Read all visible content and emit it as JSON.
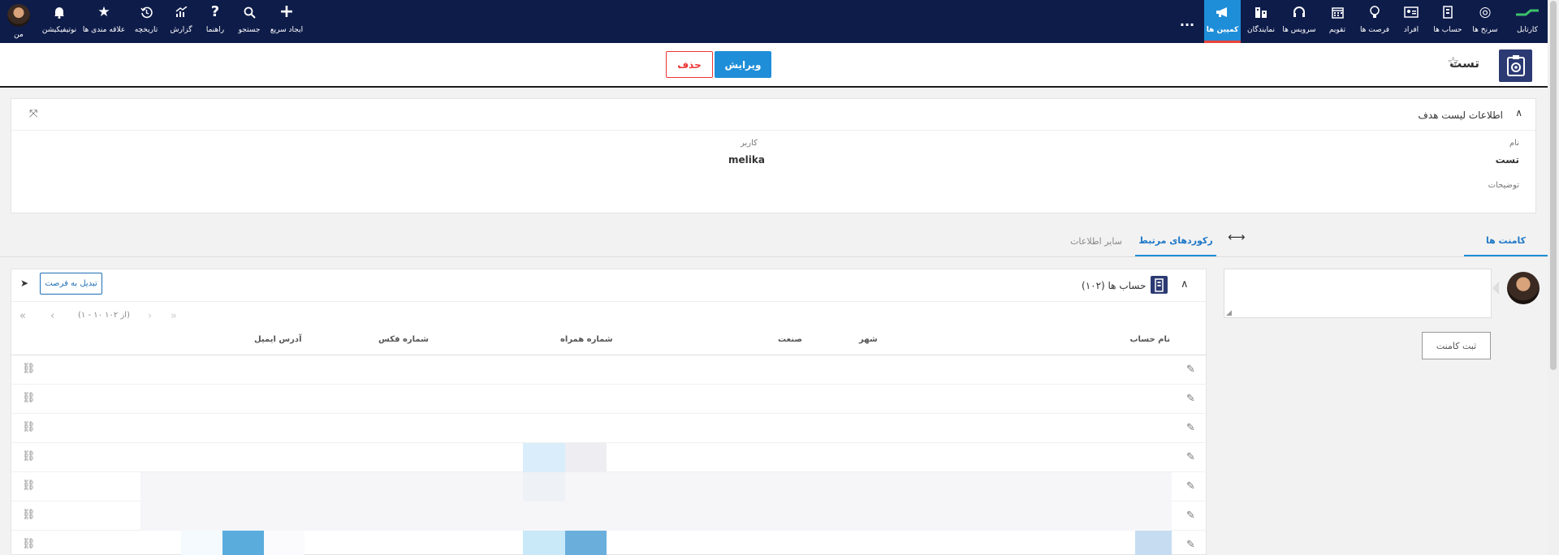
{
  "topnav": {
    "items": [
      {
        "label": "کارتابل",
        "icon": "dash-icon"
      },
      {
        "label": "سرنخ ها",
        "icon": "target-icon"
      },
      {
        "label": "حساب ها",
        "icon": "building-icon"
      },
      {
        "label": "افراد",
        "icon": "contact-card-icon"
      },
      {
        "label": "فرصت ها",
        "icon": "bulb-icon"
      },
      {
        "label": "تقویم",
        "icon": "calendar-icon"
      },
      {
        "label": "سرویس ها",
        "icon": "headset-icon"
      },
      {
        "label": "نمایندگان",
        "icon": "buildings-icon"
      },
      {
        "label": "کمپین ها",
        "icon": "megaphone-icon"
      }
    ],
    "more": "...",
    "left_items": [
      {
        "label": "ایجاد سریع",
        "icon": "plus-icon"
      },
      {
        "label": "جستجو",
        "icon": "search-icon"
      },
      {
        "label": "راهنما",
        "icon": "help-icon"
      },
      {
        "label": "گزارش",
        "icon": "chart-icon"
      },
      {
        "label": "تاریخچه",
        "icon": "history-icon"
      },
      {
        "label": "علاقه مندی ها",
        "icon": "star-icon"
      },
      {
        "label": "نوتیفیکیشن",
        "icon": "bell-icon"
      },
      {
        "label": "من",
        "icon": "avatar"
      }
    ],
    "accent": "#1f8ed8",
    "background": "#0e1c4a"
  },
  "header": {
    "title": "تست",
    "edit_label": "ویرایش",
    "delete_label": "حذف"
  },
  "info": {
    "section_title": "اطلاعات لیست هدف",
    "name_label": "نام",
    "name_value": "تست",
    "user_label": "کاربر",
    "user_value": "melika",
    "desc_label": "توضیحات"
  },
  "tabs": {
    "comments": "کامنت ها",
    "related": "رکوردهای مرتبط",
    "other": "سایر اطلاعات"
  },
  "comments": {
    "submit_label": "ثبت کامنت"
  },
  "related": {
    "title": "حساب ها (۱۰۲)",
    "convert_label": "تبدیل به فرصت",
    "pager_info": "(۱ - ۱۰ از ۱۰۲)",
    "columns": [
      "نام حساب",
      "شهر",
      "صنعت",
      "شماره همراه",
      "شماره فکس",
      "آدرس ایمیل"
    ]
  }
}
